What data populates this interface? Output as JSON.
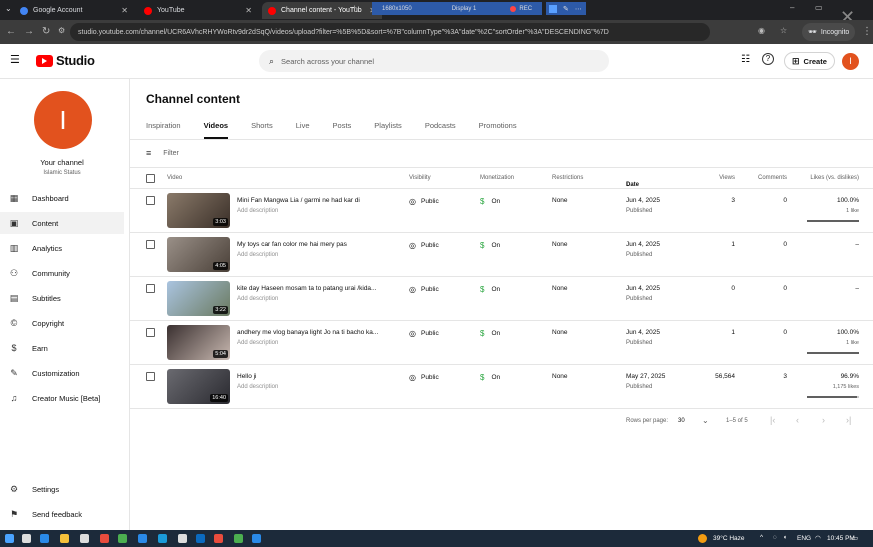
{
  "browser": {
    "tabs": [
      {
        "title": "Google Account",
        "color": "#4285f4"
      },
      {
        "title": "YouTube",
        "color": "#ff0000"
      },
      {
        "title": "Channel content - YouTub",
        "color": "#ff0000"
      }
    ],
    "overlay": {
      "resolution": "1680x1050",
      "display": "Display 1",
      "rec": "REC"
    },
    "url": "studio.youtube.com/channel/UCR6AVhcRHYWoRtv9dr2dSqQ/videos/upload?filter=%5B%5D&sort=%7B\"columnType\"%3A\"date\"%2C\"sortOrder\"%3A\"DESCENDING\"%7D",
    "incognito_label": "Incognito"
  },
  "header": {
    "logo_text": "Studio",
    "search_placeholder": "Search across your channel",
    "create_label": "Create",
    "avatar_letter": "I"
  },
  "sidebar": {
    "avatar_letter": "I",
    "your_channel_label": "Your channel",
    "channel_name": "Islamic Status",
    "items": [
      {
        "label": "Dashboard",
        "icon": "dashboard-icon",
        "glyph": "▦"
      },
      {
        "label": "Content",
        "icon": "content-icon",
        "glyph": "▣"
      },
      {
        "label": "Analytics",
        "icon": "analytics-icon",
        "glyph": "▥"
      },
      {
        "label": "Community",
        "icon": "community-icon",
        "glyph": "⚇"
      },
      {
        "label": "Subtitles",
        "icon": "subtitles-icon",
        "glyph": "▤"
      },
      {
        "label": "Copyright",
        "icon": "copyright-icon",
        "glyph": "©"
      },
      {
        "label": "Earn",
        "icon": "earn-icon",
        "glyph": "$"
      },
      {
        "label": "Customization",
        "icon": "customization-icon",
        "glyph": "✎"
      },
      {
        "label": "Creator Music [Beta]",
        "icon": "creator-music-icon",
        "glyph": "♫"
      }
    ],
    "settings_label": "Settings",
    "feedback_label": "Send feedback"
  },
  "main": {
    "title": "Channel content",
    "tabs": [
      "Inspiration",
      "Videos",
      "Shorts",
      "Live",
      "Posts",
      "Playlists",
      "Podcasts",
      "Promotions"
    ],
    "active_tab": "Videos",
    "filter_label": "Filter",
    "columns": {
      "video": "Video",
      "visibility": "Visibility",
      "monetization": "Monetization",
      "restrictions": "Restrictions",
      "date": "Date",
      "views": "Views",
      "comments": "Comments",
      "likes": "Likes (vs. dislikes)"
    },
    "rows": [
      {
        "title": "Mini Fan Mangwa Lia / garmi ne had kar di",
        "desc": "Add description",
        "duration": "3:03",
        "visibility": "Public",
        "monetization": "On",
        "restrictions": "None",
        "date": "Jun 4, 2025",
        "status": "Published",
        "views": "3",
        "comments": "0",
        "likes": "100.0%",
        "likes_sub": "1 like",
        "like_ratio": 1.0,
        "thumb": [
          "#8a7a6a",
          "#3a2f28"
        ]
      },
      {
        "title": "My toys car fan color me hai mery pas",
        "desc": "Add description",
        "duration": "4:05",
        "visibility": "Public",
        "monetization": "On",
        "restrictions": "None",
        "date": "Jun 4, 2025",
        "status": "Published",
        "views": "1",
        "comments": "0",
        "likes": "–",
        "likes_sub": "",
        "like_ratio": null,
        "thumb": [
          "#9a9088",
          "#4a4038"
        ]
      },
      {
        "title": "kite day Haseen mosam ta to patang urai /kida...",
        "desc": "Add description",
        "duration": "3:22",
        "visibility": "Public",
        "monetization": "On",
        "restrictions": "None",
        "date": "Jun 4, 2025",
        "status": "Published",
        "views": "0",
        "comments": "0",
        "likes": "–",
        "likes_sub": "",
        "like_ratio": null,
        "thumb": [
          "#aac4e0",
          "#6a7a60"
        ]
      },
      {
        "title": "andhery me vlog banaya light Jo na ti bacho ka...",
        "desc": "Add description",
        "duration": "5:04",
        "visibility": "Public",
        "monetization": "On",
        "restrictions": "None",
        "date": "Jun 4, 2025",
        "status": "Published",
        "views": "1",
        "comments": "0",
        "likes": "100.0%",
        "likes_sub": "1 like",
        "like_ratio": 1.0,
        "thumb": [
          "#3a3030",
          "#c8b8b0"
        ]
      },
      {
        "title": "Hello ji",
        "desc": "Add description",
        "duration": "16:40",
        "visibility": "Public",
        "monetization": "On",
        "restrictions": "None",
        "date": "May 27, 2025",
        "status": "Published",
        "views": "56,564",
        "comments": "3",
        "likes": "96.9%",
        "likes_sub": "1,175 likes",
        "like_ratio": 0.969,
        "thumb": [
          "#6a6a70",
          "#2a2a30"
        ]
      }
    ],
    "pagination": {
      "rows_per_page_label": "Rows per page:",
      "rows_per_page": "30",
      "range": "1–5 of 5"
    }
  },
  "taskbar": {
    "weather": "39°C  Haze",
    "lang": "ENG",
    "time": "10:45 PM"
  }
}
